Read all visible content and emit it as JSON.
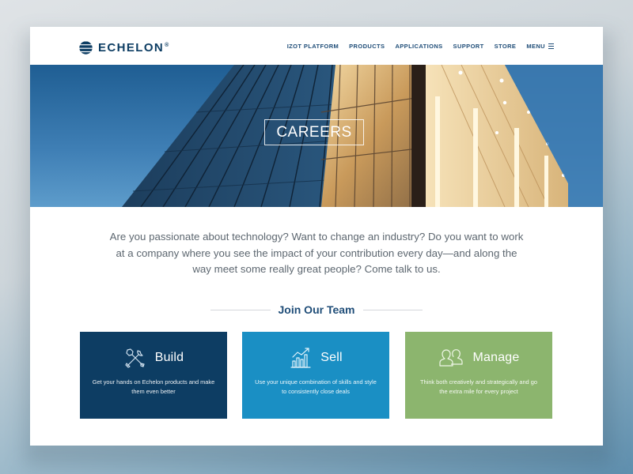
{
  "brand": {
    "name": "ECHELON",
    "reg_mark": "®",
    "colors": {
      "navy": "#0d3d63",
      "blue": "#1a8fc4",
      "green": "#8cb56e",
      "text": "#5d6770"
    }
  },
  "nav": {
    "items": [
      "IZOT PLATFORM",
      "PRODUCTS",
      "APPLICATIONS",
      "SUPPORT",
      "STORE"
    ],
    "menu_label": "MENU",
    "menu_icon": "hamburger-icon"
  },
  "hero": {
    "title": "CAREERS",
    "image": "glass-building-photo"
  },
  "intro": {
    "text": "Are you passionate about technology? Want to change an industry? Do you want to work at a company where you see the impact of your contribution every day—and along the way meet some really great people? Come talk to us."
  },
  "section": {
    "title": "Join Our Team"
  },
  "cards": [
    {
      "title": "Build",
      "icon": "wrench-screwdriver-icon",
      "description": "Get your hands on Echelon products and make them even better"
    },
    {
      "title": "Sell",
      "icon": "growth-chart-icon",
      "description": "Use your unique combination of skills and style to consistently close deals"
    },
    {
      "title": "Manage",
      "icon": "people-icon",
      "description": "Think both creatively and strategically and go the extra mile for every project"
    }
  ]
}
